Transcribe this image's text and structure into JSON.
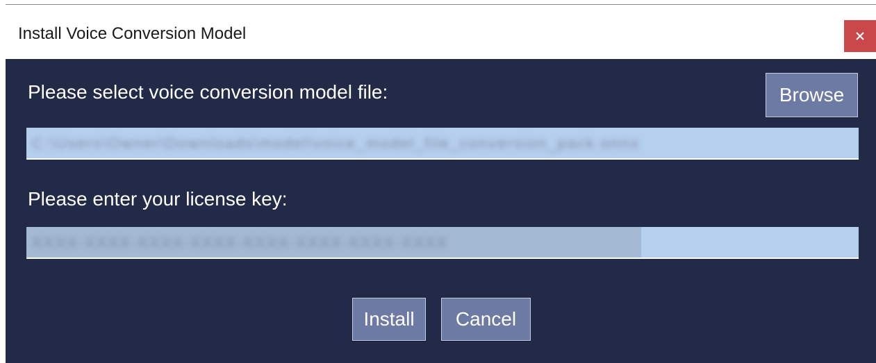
{
  "window": {
    "title": "Install Voice Conversion Model",
    "close_glyph": "×"
  },
  "form": {
    "model_file_label": "Please select voice conversion model file:",
    "browse_label": "Browse",
    "model_file_value": "C:\\Users\\Owner\\Downloads\\model\\voice_model_file_conversion_pack.onnx",
    "license_label": "Please enter your license key:",
    "license_value": "XXXX-XXXX-XXXX-XXXX-XXXX-XXXX-XXXX-XXXX"
  },
  "actions": {
    "install_label": "Install",
    "cancel_label": "Cancel"
  },
  "colors": {
    "body_bg": "#222a47",
    "button_bg": "#6d7aa3",
    "field_bg": "#b6cfee",
    "close_bg": "#c9484a"
  }
}
